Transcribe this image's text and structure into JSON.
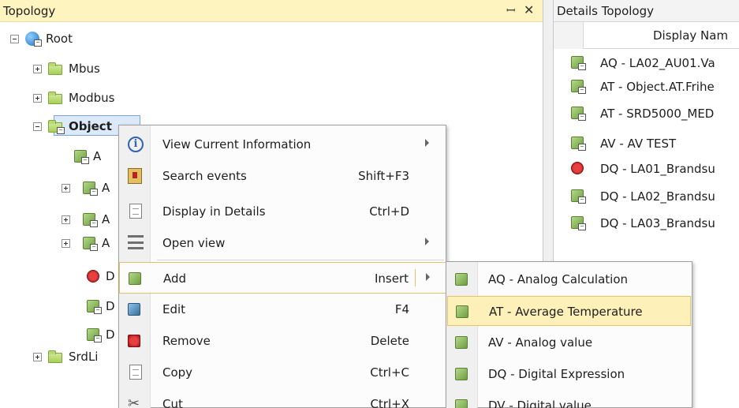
{
  "left_panel": {
    "title": "Topology",
    "pin_icon": "pin-icon",
    "close_icon": "close-icon",
    "tree": [
      {
        "label": "Root",
        "icon": "globe-icon",
        "expander": "minus"
      },
      {
        "label": "Mbus",
        "icon": "folder-icon",
        "expander": "plus"
      },
      {
        "label": "Modbus",
        "icon": "folder-icon",
        "expander": "plus"
      },
      {
        "label": "Object",
        "icon": "folder-icon",
        "expander": "minus",
        "selected": true
      },
      {
        "label": "A",
        "icon": "object-icon"
      },
      {
        "label": "A",
        "icon": "object-icon",
        "expander": "plus"
      },
      {
        "label": "A",
        "icon": "object-icon",
        "expander": "plus"
      },
      {
        "label": "A",
        "icon": "object-icon",
        "expander": "plus"
      },
      {
        "label": "D",
        "icon": "alarm-object-icon"
      },
      {
        "label": "D",
        "icon": "object-icon"
      },
      {
        "label": "D",
        "icon": "object-icon"
      },
      {
        "label": "SrdLi",
        "icon": "folder-icon",
        "expander": "plus"
      }
    ]
  },
  "right_panel": {
    "title": "Details Topology",
    "column_header": "Display Nam",
    "rows": [
      {
        "label": "AQ - LA02_AU01.Va",
        "icon": "object-icon"
      },
      {
        "label": "AT - Object.AT.Frihe",
        "icon": "object-icon"
      },
      {
        "label": "AT - SRD5000_MED",
        "icon": "object-icon"
      },
      {
        "label": "AV - AV TEST",
        "icon": "object-icon"
      },
      {
        "label": "DQ - LA01_Brandsu",
        "icon": "alarm-object-icon"
      },
      {
        "label": "DQ - LA02_Brandsu",
        "icon": "object-icon"
      },
      {
        "label": "DQ - LA03_Brandsu",
        "icon": "object-icon"
      }
    ]
  },
  "context_menu": {
    "items": [
      {
        "label": "View Current Information",
        "shortcut": "",
        "icon": "info-icon",
        "submenu": true
      },
      {
        "label": "Search events",
        "shortcut": "Shift+F3",
        "icon": "search-events-icon",
        "submenu": false
      },
      {
        "label": "Display in Details",
        "shortcut": "Ctrl+D",
        "icon": "display-details-icon",
        "submenu": false
      },
      {
        "label": "Open view",
        "shortcut": "",
        "icon": "open-view-icon",
        "submenu": true
      },
      {
        "label": "Add",
        "shortcut": "Insert",
        "icon": "add-icon",
        "submenu": true,
        "highlighted": true
      },
      {
        "label": "Edit",
        "shortcut": "F4",
        "icon": "edit-icon",
        "submenu": false
      },
      {
        "label": "Remove",
        "shortcut": "Delete",
        "icon": "remove-icon",
        "submenu": false
      },
      {
        "label": "Copy",
        "shortcut": "Ctrl+C",
        "icon": "copy-icon",
        "submenu": false
      },
      {
        "label": "Cut",
        "shortcut": "Ctrl+X",
        "icon": "cut-icon",
        "submenu": false
      }
    ]
  },
  "add_submenu": {
    "items": [
      {
        "label": "AQ - Analog Calculation",
        "icon": "object-icon"
      },
      {
        "label": "AT - Average Temperature",
        "icon": "object-icon",
        "highlighted": true
      },
      {
        "label": "AV - Analog value",
        "icon": "object-icon"
      },
      {
        "label": "DQ - Digital Expression",
        "icon": "object-icon"
      },
      {
        "label": "DV - Digital value",
        "icon": "object-icon"
      }
    ]
  },
  "colors": {
    "panel_header": "#fdf4bf",
    "selection": "#dbe9f8",
    "menu_highlight": "#fdf0b8",
    "menu_highlight_border": "#e3c465"
  }
}
